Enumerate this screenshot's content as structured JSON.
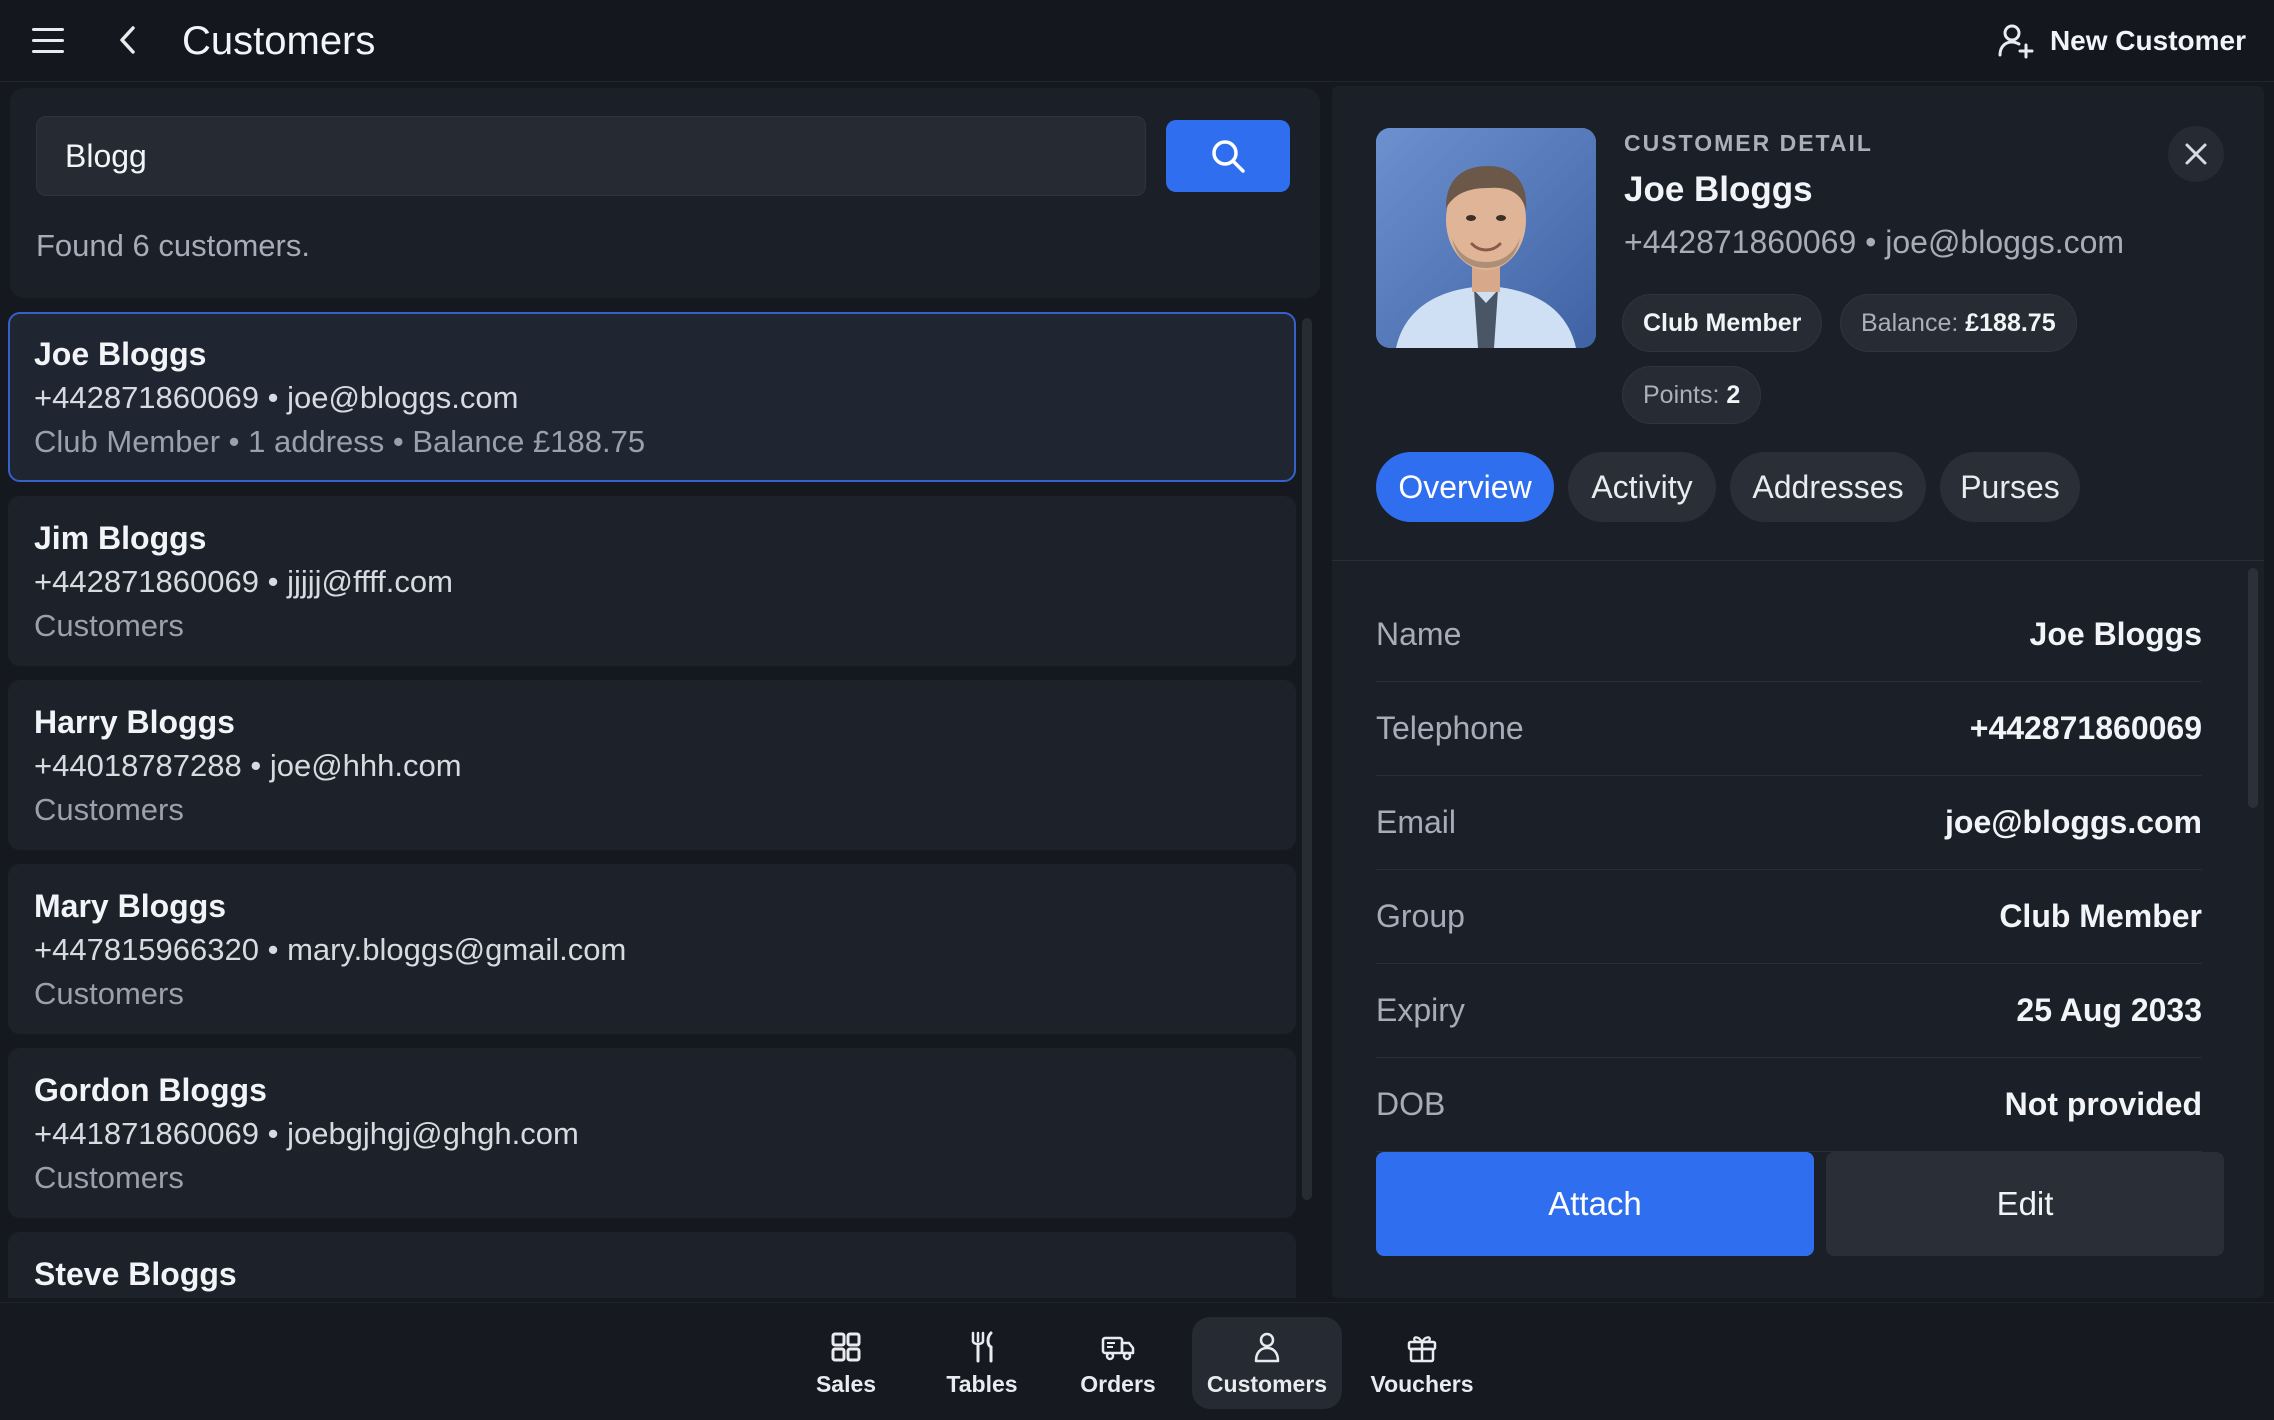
{
  "header": {
    "title": "Customers",
    "new_customer_label": "New Customer"
  },
  "search": {
    "value": "Blogg",
    "placeholder": "",
    "found_text": "Found 6 customers."
  },
  "results": [
    {
      "name": "Joe Bloggs",
      "contact": "+442871860069 • joe@bloggs.com",
      "meta": "Club Member • 1 address • Balance £188.75",
      "selected": true
    },
    {
      "name": "Jim Bloggs",
      "contact": "+442871860069 • jjjjj@ffff.com",
      "meta": "Customers",
      "selected": false
    },
    {
      "name": "Harry Bloggs",
      "contact": "+44018787288 • joe@hhh.com",
      "meta": "Customers",
      "selected": false
    },
    {
      "name": "Mary Bloggs",
      "contact": "+447815966320 • mary.bloggs@gmail.com",
      "meta": "Customers",
      "selected": false
    },
    {
      "name": "Gordon Bloggs",
      "contact": "+441871860069 • joebgjhgj@ghgh.com",
      "meta": "Customers",
      "selected": false
    },
    {
      "name": "Steve Bloggs",
      "contact": "",
      "meta": "",
      "selected": false
    }
  ],
  "detail": {
    "kicker": "CUSTOMER DETAIL",
    "name": "Joe Bloggs",
    "contact": "+442871860069 • joe@bloggs.com",
    "group_chip": "Club Member",
    "balance_label": "Balance:",
    "balance_value": "£188.75",
    "points_label": "Points:",
    "points_value": "2",
    "tabs": [
      {
        "label": "Overview",
        "active": true
      },
      {
        "label": "Activity",
        "active": false
      },
      {
        "label": "Addresses",
        "active": false
      },
      {
        "label": "Purses",
        "active": false
      }
    ],
    "fields": [
      {
        "label": "Name",
        "value": "Joe Bloggs"
      },
      {
        "label": "Telephone",
        "value": "+442871860069"
      },
      {
        "label": "Email",
        "value": "joe@bloggs.com"
      },
      {
        "label": "Group",
        "value": "Club Member"
      },
      {
        "label": "Expiry",
        "value": "25 Aug 2033"
      },
      {
        "label": "DOB",
        "value": "Not provided"
      }
    ],
    "attach_label": "Attach",
    "edit_label": "Edit"
  },
  "nav": [
    {
      "label": "Sales",
      "icon": "grid-icon",
      "active": false
    },
    {
      "label": "Tables",
      "icon": "fork-knife-icon",
      "active": false
    },
    {
      "label": "Orders",
      "icon": "delivery-truck-icon",
      "active": false
    },
    {
      "label": "Customers",
      "icon": "user-icon",
      "active": true
    },
    {
      "label": "Vouchers",
      "icon": "gift-icon",
      "active": false
    }
  ],
  "colors": {
    "accent": "#2f6fef",
    "background": "#15181f",
    "panel": "#1b1f27",
    "selected_border": "#3561c9"
  }
}
